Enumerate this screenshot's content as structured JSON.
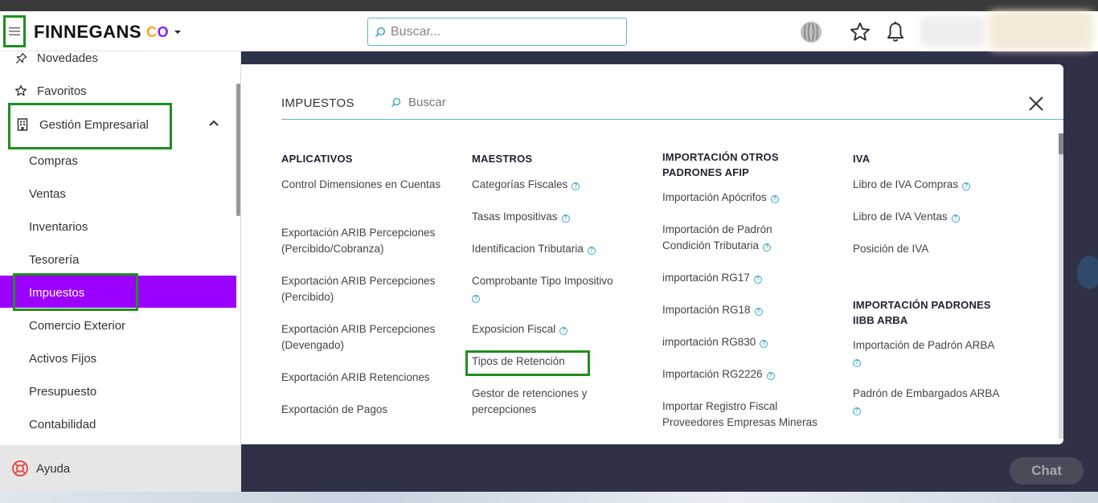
{
  "header": {
    "logo_text": "FINNEGANS",
    "logo_co": [
      "C",
      "O"
    ],
    "search_placeholder": "Buscar..."
  },
  "sidebar": {
    "items": [
      {
        "label": "Novedades",
        "icon": "pin-icon"
      },
      {
        "label": "Favoritos",
        "icon": "star-outline-icon"
      },
      {
        "label": "Gestión Empresarial",
        "icon": "building-icon"
      }
    ],
    "sub_items": [
      "Compras",
      "Ventas",
      "Inventarios",
      "Tesorería",
      "Impuestos",
      "Comercio Exterior",
      "Activos Fijos",
      "Presupuesto",
      "Contabilidad"
    ],
    "active_item": "Impuestos",
    "help_label": "Ayuda"
  },
  "panel": {
    "title": "IMPUESTOS",
    "search_placeholder": "Buscar",
    "columns": [
      {
        "heading": "APLICATIVOS",
        "links": [
          {
            "label": "Control Dimensiones en Cuentas",
            "help": false
          },
          {
            "label": "Exportación ARIB Percepciones (Percibido/Cobranza)",
            "help": false
          },
          {
            "label": "Exportación ARIB Percepciones (Percibido)",
            "help": false
          },
          {
            "label": "Exportación ARIB Percepciones (Devengado)",
            "help": false
          },
          {
            "label": "Exportación ARIB Retenciones",
            "help": false
          },
          {
            "label": "Exportación de Pagos",
            "help": false
          }
        ]
      },
      {
        "heading": "MAESTROS",
        "links": [
          {
            "label": "Categorías Fiscales",
            "help": true
          },
          {
            "label": "Tasas Impositivas",
            "help": true
          },
          {
            "label": "Identificacion Tributaria",
            "help": true
          },
          {
            "label": "Comprobante Tipo Impositivo",
            "help": true
          },
          {
            "label": "Exposicion Fiscal",
            "help": true
          },
          {
            "label": "Tipos de Retención",
            "help": false
          },
          {
            "label": "Gestor de retenciones y percepciones",
            "help": false
          }
        ]
      },
      {
        "heading": "IMPORTACIÓN OTROS PADRONES AFIP",
        "links": [
          {
            "label": "Importación Apócrifos",
            "help": true
          },
          {
            "label": "Importación de Padrón Condición Tributaria",
            "help": true
          },
          {
            "label": "importación RG17",
            "help": true
          },
          {
            "label": "Importación RG18",
            "help": true
          },
          {
            "label": "importación RG830",
            "help": true
          },
          {
            "label": "Importación RG2226",
            "help": true
          },
          {
            "label": "Importar Registro Fiscal Proveedores Empresas Mineras",
            "help": false
          }
        ]
      },
      {
        "heading": "IVA",
        "links": [
          {
            "label": "Libro de IVA Compras",
            "help": true
          },
          {
            "label": "Libro de IVA Ventas",
            "help": true
          },
          {
            "label": "Posición de IVA",
            "help": false
          }
        ]
      },
      {
        "heading": "IMPORTACIÓN PADRONES IIBB ARBA",
        "links": [
          {
            "label": "Importación de Padrón ARBA",
            "help": true
          },
          {
            "label": "Padrón de Embargados ARBA",
            "help": true
          }
        ]
      }
    ]
  },
  "chat_label": "Chat",
  "colors": {
    "active": "#9b00ff",
    "highlight_box": "#1f8f1f",
    "accent": "#39a6c8",
    "backdrop": "#2f3147"
  }
}
